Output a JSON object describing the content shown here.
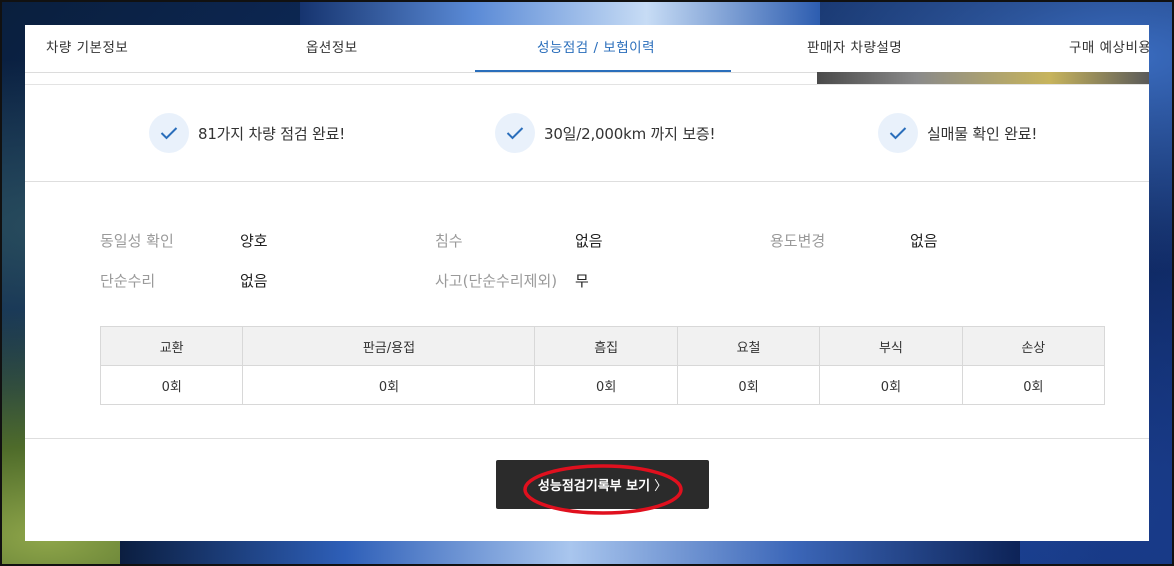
{
  "tabs": [
    {
      "label": "차량 기본정보"
    },
    {
      "label": "옵션정보"
    },
    {
      "label": "성능점검 / 보험이력",
      "active": true
    },
    {
      "label": "판매자 차량설명"
    },
    {
      "label": "구매 예상비용"
    }
  ],
  "checks": [
    {
      "text": "81가지 차량 점검 완료!",
      "icon": "check-icon"
    },
    {
      "text": "30일/2,000km 까지 보증!",
      "icon": "check-icon"
    },
    {
      "text": "실매물 확인 완료!",
      "icon": "check-icon"
    }
  ],
  "info": {
    "identity_label": "동일성 확인",
    "identity_value": "양호",
    "flood_label": "침수",
    "flood_value": "없음",
    "usage_label": "용도변경",
    "usage_value": "없음",
    "repair_label": "단순수리",
    "repair_value": "없음",
    "accident_label": "사고(단순수리제외)",
    "accident_value": "무"
  },
  "repair_table": {
    "headers": [
      "교환",
      "판금/용접",
      "흠집",
      "요철",
      "부식",
      "손상"
    ],
    "values": [
      "0회",
      "0회",
      "0회",
      "0회",
      "0회",
      "0회"
    ]
  },
  "view_button": {
    "label": "성능점검기록부 보기",
    "chevron": "〉"
  },
  "colors": {
    "accent": "#2a6ebb",
    "button_bg": "#2b2b2b",
    "annotation": "#e0101e"
  }
}
